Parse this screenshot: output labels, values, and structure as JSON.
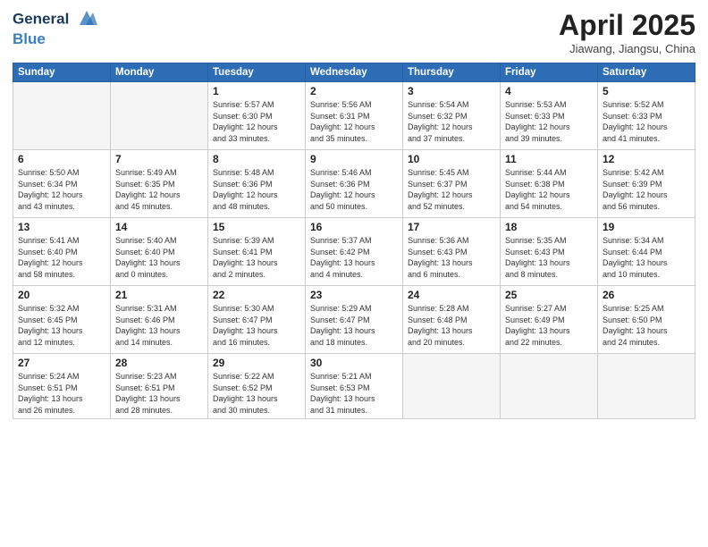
{
  "header": {
    "logo_line1": "General",
    "logo_line2": "Blue",
    "month_title": "April 2025",
    "location": "Jiawang, Jiangsu, China"
  },
  "weekdays": [
    "Sunday",
    "Monday",
    "Tuesday",
    "Wednesday",
    "Thursday",
    "Friday",
    "Saturday"
  ],
  "weeks": [
    [
      {
        "day": "",
        "info": ""
      },
      {
        "day": "",
        "info": ""
      },
      {
        "day": "1",
        "info": "Sunrise: 5:57 AM\nSunset: 6:30 PM\nDaylight: 12 hours\nand 33 minutes."
      },
      {
        "day": "2",
        "info": "Sunrise: 5:56 AM\nSunset: 6:31 PM\nDaylight: 12 hours\nand 35 minutes."
      },
      {
        "day": "3",
        "info": "Sunrise: 5:54 AM\nSunset: 6:32 PM\nDaylight: 12 hours\nand 37 minutes."
      },
      {
        "day": "4",
        "info": "Sunrise: 5:53 AM\nSunset: 6:33 PM\nDaylight: 12 hours\nand 39 minutes."
      },
      {
        "day": "5",
        "info": "Sunrise: 5:52 AM\nSunset: 6:33 PM\nDaylight: 12 hours\nand 41 minutes."
      }
    ],
    [
      {
        "day": "6",
        "info": "Sunrise: 5:50 AM\nSunset: 6:34 PM\nDaylight: 12 hours\nand 43 minutes."
      },
      {
        "day": "7",
        "info": "Sunrise: 5:49 AM\nSunset: 6:35 PM\nDaylight: 12 hours\nand 45 minutes."
      },
      {
        "day": "8",
        "info": "Sunrise: 5:48 AM\nSunset: 6:36 PM\nDaylight: 12 hours\nand 48 minutes."
      },
      {
        "day": "9",
        "info": "Sunrise: 5:46 AM\nSunset: 6:36 PM\nDaylight: 12 hours\nand 50 minutes."
      },
      {
        "day": "10",
        "info": "Sunrise: 5:45 AM\nSunset: 6:37 PM\nDaylight: 12 hours\nand 52 minutes."
      },
      {
        "day": "11",
        "info": "Sunrise: 5:44 AM\nSunset: 6:38 PM\nDaylight: 12 hours\nand 54 minutes."
      },
      {
        "day": "12",
        "info": "Sunrise: 5:42 AM\nSunset: 6:39 PM\nDaylight: 12 hours\nand 56 minutes."
      }
    ],
    [
      {
        "day": "13",
        "info": "Sunrise: 5:41 AM\nSunset: 6:40 PM\nDaylight: 12 hours\nand 58 minutes."
      },
      {
        "day": "14",
        "info": "Sunrise: 5:40 AM\nSunset: 6:40 PM\nDaylight: 13 hours\nand 0 minutes."
      },
      {
        "day": "15",
        "info": "Sunrise: 5:39 AM\nSunset: 6:41 PM\nDaylight: 13 hours\nand 2 minutes."
      },
      {
        "day": "16",
        "info": "Sunrise: 5:37 AM\nSunset: 6:42 PM\nDaylight: 13 hours\nand 4 minutes."
      },
      {
        "day": "17",
        "info": "Sunrise: 5:36 AM\nSunset: 6:43 PM\nDaylight: 13 hours\nand 6 minutes."
      },
      {
        "day": "18",
        "info": "Sunrise: 5:35 AM\nSunset: 6:43 PM\nDaylight: 13 hours\nand 8 minutes."
      },
      {
        "day": "19",
        "info": "Sunrise: 5:34 AM\nSunset: 6:44 PM\nDaylight: 13 hours\nand 10 minutes."
      }
    ],
    [
      {
        "day": "20",
        "info": "Sunrise: 5:32 AM\nSunset: 6:45 PM\nDaylight: 13 hours\nand 12 minutes."
      },
      {
        "day": "21",
        "info": "Sunrise: 5:31 AM\nSunset: 6:46 PM\nDaylight: 13 hours\nand 14 minutes."
      },
      {
        "day": "22",
        "info": "Sunrise: 5:30 AM\nSunset: 6:47 PM\nDaylight: 13 hours\nand 16 minutes."
      },
      {
        "day": "23",
        "info": "Sunrise: 5:29 AM\nSunset: 6:47 PM\nDaylight: 13 hours\nand 18 minutes."
      },
      {
        "day": "24",
        "info": "Sunrise: 5:28 AM\nSunset: 6:48 PM\nDaylight: 13 hours\nand 20 minutes."
      },
      {
        "day": "25",
        "info": "Sunrise: 5:27 AM\nSunset: 6:49 PM\nDaylight: 13 hours\nand 22 minutes."
      },
      {
        "day": "26",
        "info": "Sunrise: 5:25 AM\nSunset: 6:50 PM\nDaylight: 13 hours\nand 24 minutes."
      }
    ],
    [
      {
        "day": "27",
        "info": "Sunrise: 5:24 AM\nSunset: 6:51 PM\nDaylight: 13 hours\nand 26 minutes."
      },
      {
        "day": "28",
        "info": "Sunrise: 5:23 AM\nSunset: 6:51 PM\nDaylight: 13 hours\nand 28 minutes."
      },
      {
        "day": "29",
        "info": "Sunrise: 5:22 AM\nSunset: 6:52 PM\nDaylight: 13 hours\nand 30 minutes."
      },
      {
        "day": "30",
        "info": "Sunrise: 5:21 AM\nSunset: 6:53 PM\nDaylight: 13 hours\nand 31 minutes."
      },
      {
        "day": "",
        "info": ""
      },
      {
        "day": "",
        "info": ""
      },
      {
        "day": "",
        "info": ""
      }
    ]
  ]
}
